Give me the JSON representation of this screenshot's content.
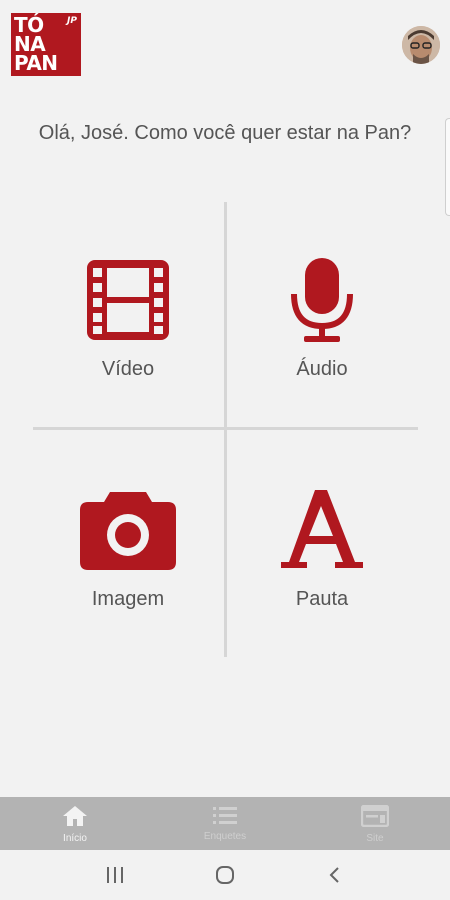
{
  "header": {
    "logo_lines": [
      "TÓ",
      "NA",
      "PAN"
    ],
    "logo_badge": "JP",
    "avatar_icon": "user-avatar"
  },
  "greeting": "Olá, José. Como você quer estar na Pan?",
  "options": [
    {
      "label": "Vídeo",
      "icon": "film-icon"
    },
    {
      "label": "Áudio",
      "icon": "microphone-icon"
    },
    {
      "label": "Imagem",
      "icon": "camera-icon"
    },
    {
      "label": "Pauta",
      "icon": "letter-a-icon"
    }
  ],
  "bottom_nav": [
    {
      "label": "Início",
      "icon": "home-icon",
      "active": true
    },
    {
      "label": "Enquetes",
      "icon": "list-icon",
      "active": false
    },
    {
      "label": "Site",
      "icon": "browser-icon",
      "active": false
    }
  ],
  "system_nav": [
    "recent-apps",
    "home",
    "back"
  ],
  "colors": {
    "brand_red": "#b0181f",
    "background": "#f2f2f2",
    "nav_background": "#b3b3b3",
    "text": "#555555"
  }
}
